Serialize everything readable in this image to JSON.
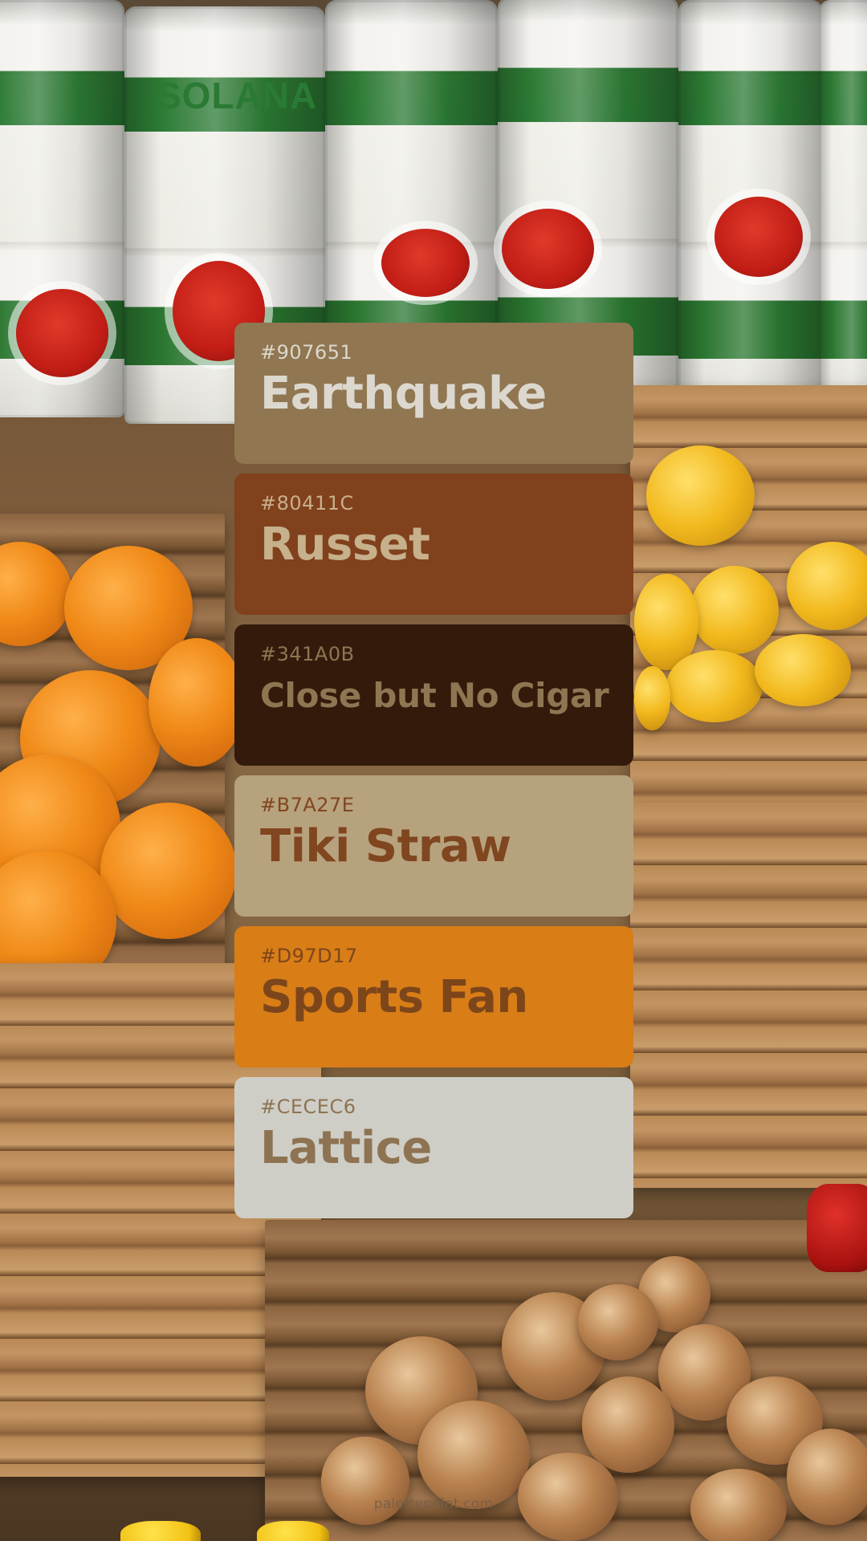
{
  "palette": {
    "colors": [
      {
        "hex": "#907651",
        "name": "Earthquake",
        "bg": "#907651",
        "text_color": "#DCD8CF"
      },
      {
        "hex": "#80411C",
        "name": "Russet",
        "bg": "#80411C",
        "text_color": "#C7B08C"
      },
      {
        "hex": "#341A0B",
        "name": "Close but No Cigar",
        "bg": "#341A0B",
        "text_color": "#8E7653"
      },
      {
        "hex": "#B7A27E",
        "name": "Tiki Straw",
        "bg": "#B7A27E",
        "text_color": "#80461F"
      },
      {
        "hex": "#D97D17",
        "name": "Sports Fan",
        "bg": "#D97D17",
        "text_color": "#7D461A"
      },
      {
        "hex": "#CECEC6",
        "name": "Lattice",
        "bg": "#CECEC6",
        "text_color": "#8E7352"
      }
    ]
  },
  "can_label": {
    "brand": "SOLANA"
  },
  "footer": {
    "site": "palettepoint.com"
  }
}
